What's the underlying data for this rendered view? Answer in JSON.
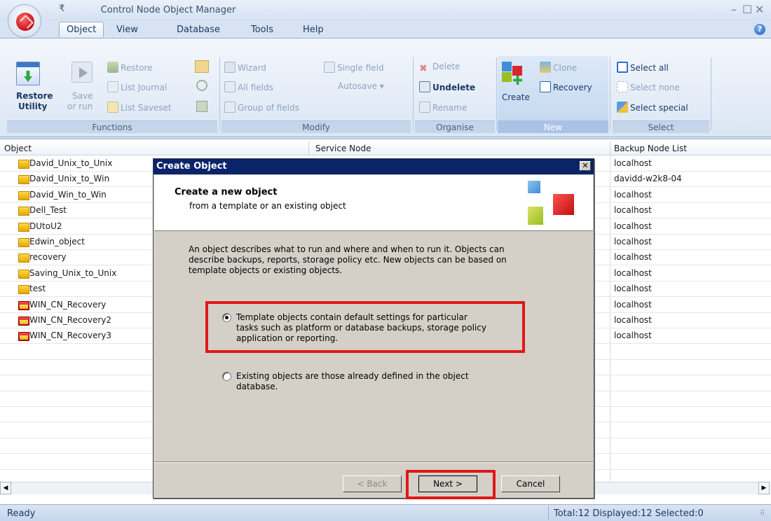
{
  "window": {
    "title": "Control Node Object Manager",
    "qat": "₹"
  },
  "tabs": [
    "Object",
    "View",
    "Database",
    "Tools",
    "Help"
  ],
  "ribbon": {
    "functions": {
      "label": "Functions",
      "restore_utility": "Restore",
      "restore_utility2": "Utility",
      "save": "Save",
      "or_run": "or run",
      "restore": "Restore",
      "list_journal": "List Journal",
      "list_saveset": "List Saveset"
    },
    "modify": {
      "label": "Modify",
      "wizard": "Wizard",
      "all_fields": "All fields",
      "group_of_fields": "Group of fields",
      "single_field": "Single field",
      "autosave": "Autosave ▾"
    },
    "organise": {
      "label": "Organise",
      "delete": "Delete",
      "undelete": "Undelete",
      "rename": "Rename"
    },
    "new": {
      "label": "New",
      "create": "Create",
      "clone": "Clone",
      "recovery": "Recovery"
    },
    "select": {
      "label": "Select",
      "select_all": "Select all",
      "select_none": "Select none",
      "select_special": "Select special"
    }
  },
  "table": {
    "headers": {
      "object": "Object",
      "service_node": "Service Node",
      "backup_node_list": "Backup Node List"
    },
    "rows": [
      {
        "name": "David_Unix_to_Unix",
        "backup": "localhost",
        "red": false
      },
      {
        "name": "David_Unix_to_Win",
        "backup": "davidd-w2k8-04",
        "red": false
      },
      {
        "name": "David_Win_to_Win",
        "backup": "localhost",
        "red": false
      },
      {
        "name": "Dell_Test",
        "backup": "localhost",
        "red": false
      },
      {
        "name": "DUtoU2",
        "backup": "localhost",
        "red": false
      },
      {
        "name": "Edwin_object",
        "backup": "localhost",
        "red": false
      },
      {
        "name": "recovery",
        "backup": "localhost",
        "red": false
      },
      {
        "name": "Saving_Unix_to_Unix",
        "backup": "localhost",
        "red": false
      },
      {
        "name": "test",
        "backup": "localhost",
        "red": false
      },
      {
        "name": "WIN_CN_Recovery",
        "backup": "localhost",
        "red": true
      },
      {
        "name": "WIN_CN_Recovery2",
        "backup": "localhost",
        "red": true
      },
      {
        "name": "WIN_CN_Recovery3",
        "backup": "localhost",
        "red": true
      }
    ]
  },
  "status": {
    "ready": "Ready",
    "summary": "Total:12  Displayed:12  Selected:0"
  },
  "dialog": {
    "title": "Create Object",
    "heading": "Create a new object",
    "subheading": "from a template or an existing object",
    "description": [
      "An object describes what to run and where and when to run it. Objects can",
      "describe backups, reports, storage policy etc. New objects can be based on",
      "template objects or existing objects."
    ],
    "option_template": [
      "Template objects contain default settings for particular",
      "tasks such as platform or database backups, storage policy",
      "application or reporting."
    ],
    "option_existing": [
      "Existing objects are those already defined in the object",
      "database."
    ],
    "back": "< Back",
    "next": "Next >",
    "cancel": "Cancel"
  },
  "colors": {
    "highlight": "#e01818",
    "dialog_title": "#0a246a"
  }
}
